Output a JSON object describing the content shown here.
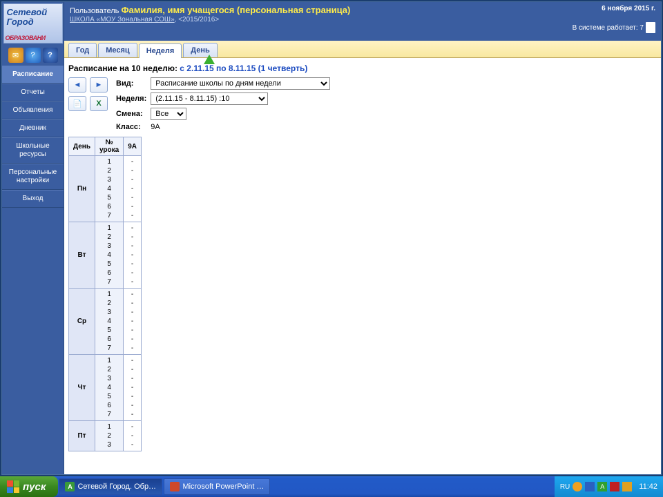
{
  "logo": {
    "line1": "Сетевой",
    "line2": "Город",
    "line3": "ОБРАЗОВАНИ"
  },
  "sidebar": {
    "icons": [
      "mail",
      "help",
      "question"
    ],
    "items": [
      {
        "label": "Расписание",
        "active": true
      },
      {
        "label": "Отчеты"
      },
      {
        "label": "Объявления"
      },
      {
        "label": "Дневник"
      },
      {
        "label": "Школьные ресурсы"
      },
      {
        "label": "Персональные настройки"
      },
      {
        "label": "Выход"
      }
    ]
  },
  "header": {
    "user_prefix": "Пользователь",
    "user_highlight": "Фамилия, имя учащегося (персональная страница)",
    "school_link": "ШКОЛА «МОУ Зональная СОШ»",
    "school_year": ", <2015/2016>",
    "date": "6 ноября 2015 г.",
    "system_status": "В системе работает: 7"
  },
  "tabs": [
    {
      "label": "Год"
    },
    {
      "label": "Месяц"
    },
    {
      "label": "Неделя",
      "active": true
    },
    {
      "label": "День"
    }
  ],
  "page": {
    "title_black": "Расписание на 10 неделю: ",
    "title_blue": "с 2.11.15 по 8.11.15 (1 четверть)"
  },
  "form": {
    "view_label": "Вид:",
    "view_value": "Расписание школы по дням недели",
    "week_label": "Неделя:",
    "week_value": "(2.11.15 - 8.11.15) :10",
    "shift_label": "Смена:",
    "shift_value": "Все",
    "class_label": "Класс:",
    "class_value": "9А"
  },
  "schedule": {
    "headers": {
      "day": "День",
      "lesson": "№ урока",
      "class": "9А"
    },
    "days": [
      {
        "name": "Пн",
        "lessons": [
          1,
          2,
          3,
          4,
          5,
          6,
          7
        ],
        "vals": [
          "-",
          "-",
          "-",
          "-",
          "-",
          "-",
          "-"
        ]
      },
      {
        "name": "Вт",
        "lessons": [
          1,
          2,
          3,
          4,
          5,
          6,
          7
        ],
        "vals": [
          "-",
          "-",
          "-",
          "-",
          "-",
          "-",
          "-"
        ]
      },
      {
        "name": "Ср",
        "lessons": [
          1,
          2,
          3,
          4,
          5,
          6,
          7
        ],
        "vals": [
          "-",
          "-",
          "-",
          "-",
          "-",
          "-",
          "-"
        ]
      },
      {
        "name": "Чт",
        "lessons": [
          1,
          2,
          3,
          4,
          5,
          6,
          7
        ],
        "vals": [
          "-",
          "-",
          "-",
          "-",
          "-",
          "-",
          "-"
        ]
      },
      {
        "name": "Пт",
        "lessons": [
          1,
          2,
          3
        ],
        "vals": [
          "-",
          "-",
          "-"
        ]
      }
    ]
  },
  "taskbar": {
    "start": "пуск",
    "items": [
      {
        "label": "Сетевой Город. Обр…",
        "color": "#3a9a3a",
        "letter": "A",
        "active": true
      },
      {
        "label": "Microsoft PowerPoint …",
        "color": "#d04828",
        "letter": "",
        "active": false
      }
    ],
    "lang": "RU",
    "clock": "11:42"
  }
}
